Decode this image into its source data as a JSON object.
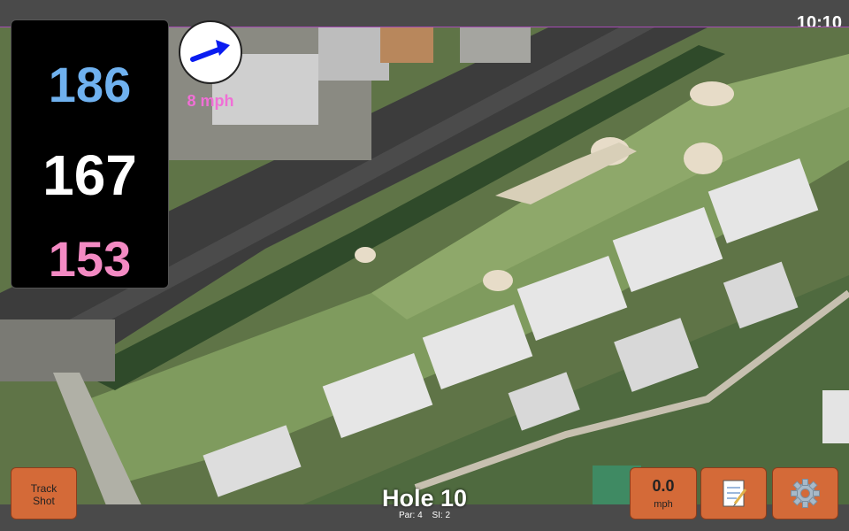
{
  "status": {
    "time": "10:10"
  },
  "distances": {
    "back": "186",
    "center": "167",
    "front": "153"
  },
  "wind": {
    "speed_label": "8 mph",
    "direction_icon": "arrow-icon"
  },
  "hole": {
    "title": "Hole 10",
    "par": "Par: 4",
    "si": "SI: 2"
  },
  "buttons": {
    "track_shot_line1": "Track",
    "track_shot_line2": "Shot",
    "speed_value": "0.0",
    "speed_unit": "mph",
    "notes_icon": "notepad-icon",
    "settings_icon": "gear-icon"
  },
  "colors": {
    "back": "#6fb1ef",
    "center": "#ffffff",
    "front": "#f38ac3",
    "wind_label": "#f06fd6",
    "button": "#d46a38",
    "fairway": "#7f9b5e"
  }
}
